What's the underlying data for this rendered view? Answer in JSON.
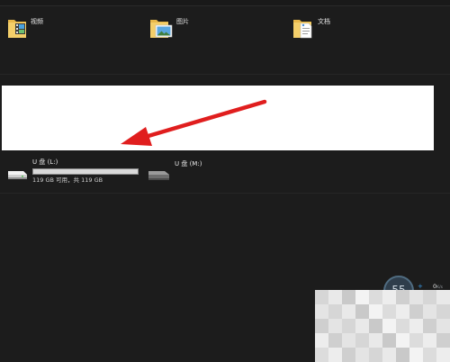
{
  "folders": [
    {
      "label": "视频",
      "icon": "video-folder-icon"
    },
    {
      "label": "图片",
      "icon": "pictures-folder-icon"
    },
    {
      "label": "文档",
      "icon": "documents-folder-icon"
    }
  ],
  "drives": [
    {
      "name": "U 盘 (L:)",
      "free_text": "119 GB 可用，共 119 GB",
      "used_fraction": 0.0,
      "icon": "usb-drive-icon"
    },
    {
      "name": "U 盘 (M:)",
      "icon": "usb-drive-icon"
    }
  ],
  "widget": {
    "gauge_value": "55",
    "plus": "+",
    "speed_value": "0",
    "speed_unit": "K/s"
  },
  "colors": {
    "background": "#1c1c1c",
    "arrow": "#e01e1e",
    "capacity_bar": "#d9d9d9"
  }
}
